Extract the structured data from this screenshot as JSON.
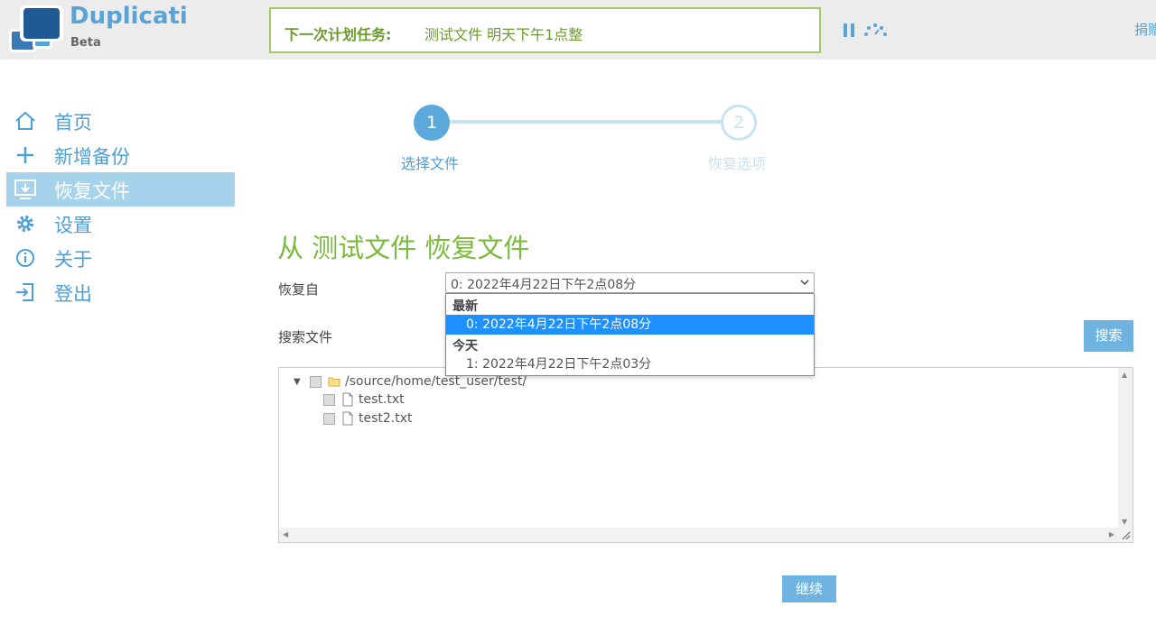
{
  "header": {
    "brand": "Duplicati",
    "beta": "Beta",
    "next_task_label": "下一次计划任务:",
    "next_task_value": "测试文件 明天下午1点整",
    "donate": "捐赠"
  },
  "sidebar": {
    "items": [
      {
        "label": "首页",
        "icon": "home-icon"
      },
      {
        "label": "新增备份",
        "icon": "plus-icon"
      },
      {
        "label": "恢复文件",
        "icon": "restore-icon",
        "active": true
      },
      {
        "label": "设置",
        "icon": "gear-icon"
      },
      {
        "label": "关于",
        "icon": "info-icon"
      },
      {
        "label": "登出",
        "icon": "logout-icon"
      }
    ]
  },
  "steps": [
    {
      "number": "1",
      "label": "选择文件",
      "active": true
    },
    {
      "number": "2",
      "label": "恢复选项",
      "active": false
    }
  ],
  "main": {
    "title": "从 测试文件 恢复文件",
    "restore_from_label": "恢复自",
    "search_label": "搜索文件",
    "search_button": "搜索",
    "continue_button": "继续"
  },
  "version_select": {
    "selected": "0: 2022年4月22日下午2点08分",
    "groups": [
      {
        "label": "最新",
        "options": [
          {
            "label": "0: 2022年4月22日下午2点08分",
            "selected": true
          }
        ]
      },
      {
        "label": "今天",
        "options": [
          {
            "label": "1: 2022年4月22日下午2点03分",
            "selected": false
          }
        ]
      }
    ]
  },
  "file_tree": {
    "root": "/source/home/test_user/test/",
    "files": [
      "test.txt",
      "test2.txt"
    ]
  },
  "colors": {
    "accent": "#5aa3d6",
    "green": "#7cba3d",
    "active_nav": "#a6d2ec",
    "selection": "#1e90ff"
  }
}
